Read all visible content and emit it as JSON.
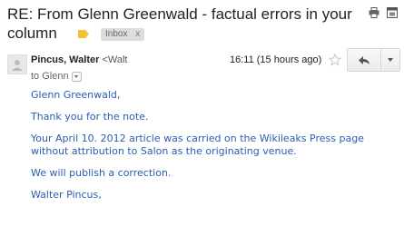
{
  "subject": {
    "text": "RE: From Glenn Greenwald - factual errors in your column",
    "label": "Inbox",
    "label_remove": "x"
  },
  "top_icons": [
    "printer-icon",
    "new-window-icon"
  ],
  "message": {
    "sender_name": "Pincus, Walter",
    "sender_email": "<Walt",
    "to": "to Glenn",
    "time": "16:11 (15 hours ago)",
    "body": [
      "Glenn Greenwald,",
      "Thank you for the note.",
      "Your April 10. 2012 article was carried on the Wikileaks Press page without attribution to Salon as the originating venue.",
      "We will publish a correction.",
      "Walter Pincus,"
    ]
  },
  "colors": {
    "body_text": "#2a5db0",
    "important_marker": "#f1c232",
    "label_bg": "#dddddd"
  }
}
